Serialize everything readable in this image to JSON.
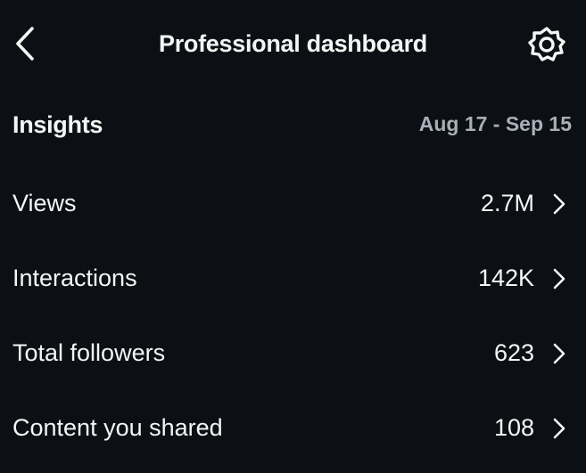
{
  "header": {
    "title": "Professional dashboard",
    "back_icon": "chevron-left-icon",
    "settings_icon": "gear-icon"
  },
  "insights": {
    "title": "Insights",
    "date_range": "Aug 17 - Sep 15"
  },
  "metrics": [
    {
      "label": "Views",
      "value": "2.7M"
    },
    {
      "label": "Interactions",
      "value": "142K"
    },
    {
      "label": "Total followers",
      "value": "623"
    },
    {
      "label": "Content you shared",
      "value": "108"
    }
  ],
  "colors": {
    "background": "#0c1014",
    "text": "#f5f5f5",
    "muted_text": "#a8afb8"
  }
}
